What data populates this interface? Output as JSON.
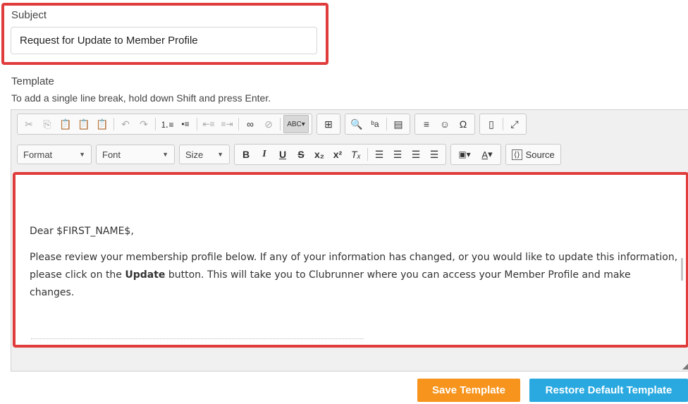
{
  "subject": {
    "label": "Subject",
    "value": "Request for Update to Member Profile"
  },
  "template": {
    "label": "Template",
    "hint": "To add a single line break, hold down Shift and press Enter."
  },
  "toolbar": {
    "row1_icons": [
      "cut-icon",
      "copy-icon",
      "paste-icon",
      "paste-text-icon",
      "paste-word-icon",
      "undo-icon",
      "redo-icon",
      "numbered-list-icon",
      "bulleted-list-icon",
      "decrease-indent-icon",
      "increase-indent-icon",
      "link-icon",
      "unlink-icon",
      "spellcheck-icon",
      "table-icon",
      "find-icon",
      "replace-icon",
      "select-all-icon",
      "horizontal-line-icon",
      "smiley-icon",
      "special-char-icon",
      "preview-icon",
      "maximize-icon"
    ],
    "format_label": "Format",
    "font_label": "Font",
    "size_label": "Size",
    "source_label": "Source",
    "row2_icons": [
      "bold-icon",
      "italic-icon",
      "underline-icon",
      "strikethrough-icon",
      "subscript-icon",
      "superscript-icon",
      "remove-format-icon",
      "align-left-icon",
      "align-center-icon",
      "align-right-icon",
      "justify-icon",
      "background-color-icon",
      "text-color-icon",
      "source-icon"
    ]
  },
  "body": {
    "greeting": "Dear $FIRST_NAME$,",
    "para_before": "Please review your membership profile below. If any of your information has changed, or you would like to update this information, please click on the ",
    "para_bold": "Update",
    "para_after": " button. This will take you to Clubrunner where you can access your Member Profile and make changes."
  },
  "buttons": {
    "save": "Save Template",
    "restore": "Restore Default Template"
  },
  "colors": {
    "highlight": "#e03c3c",
    "save": "#f7941d",
    "restore": "#29a9e0"
  }
}
